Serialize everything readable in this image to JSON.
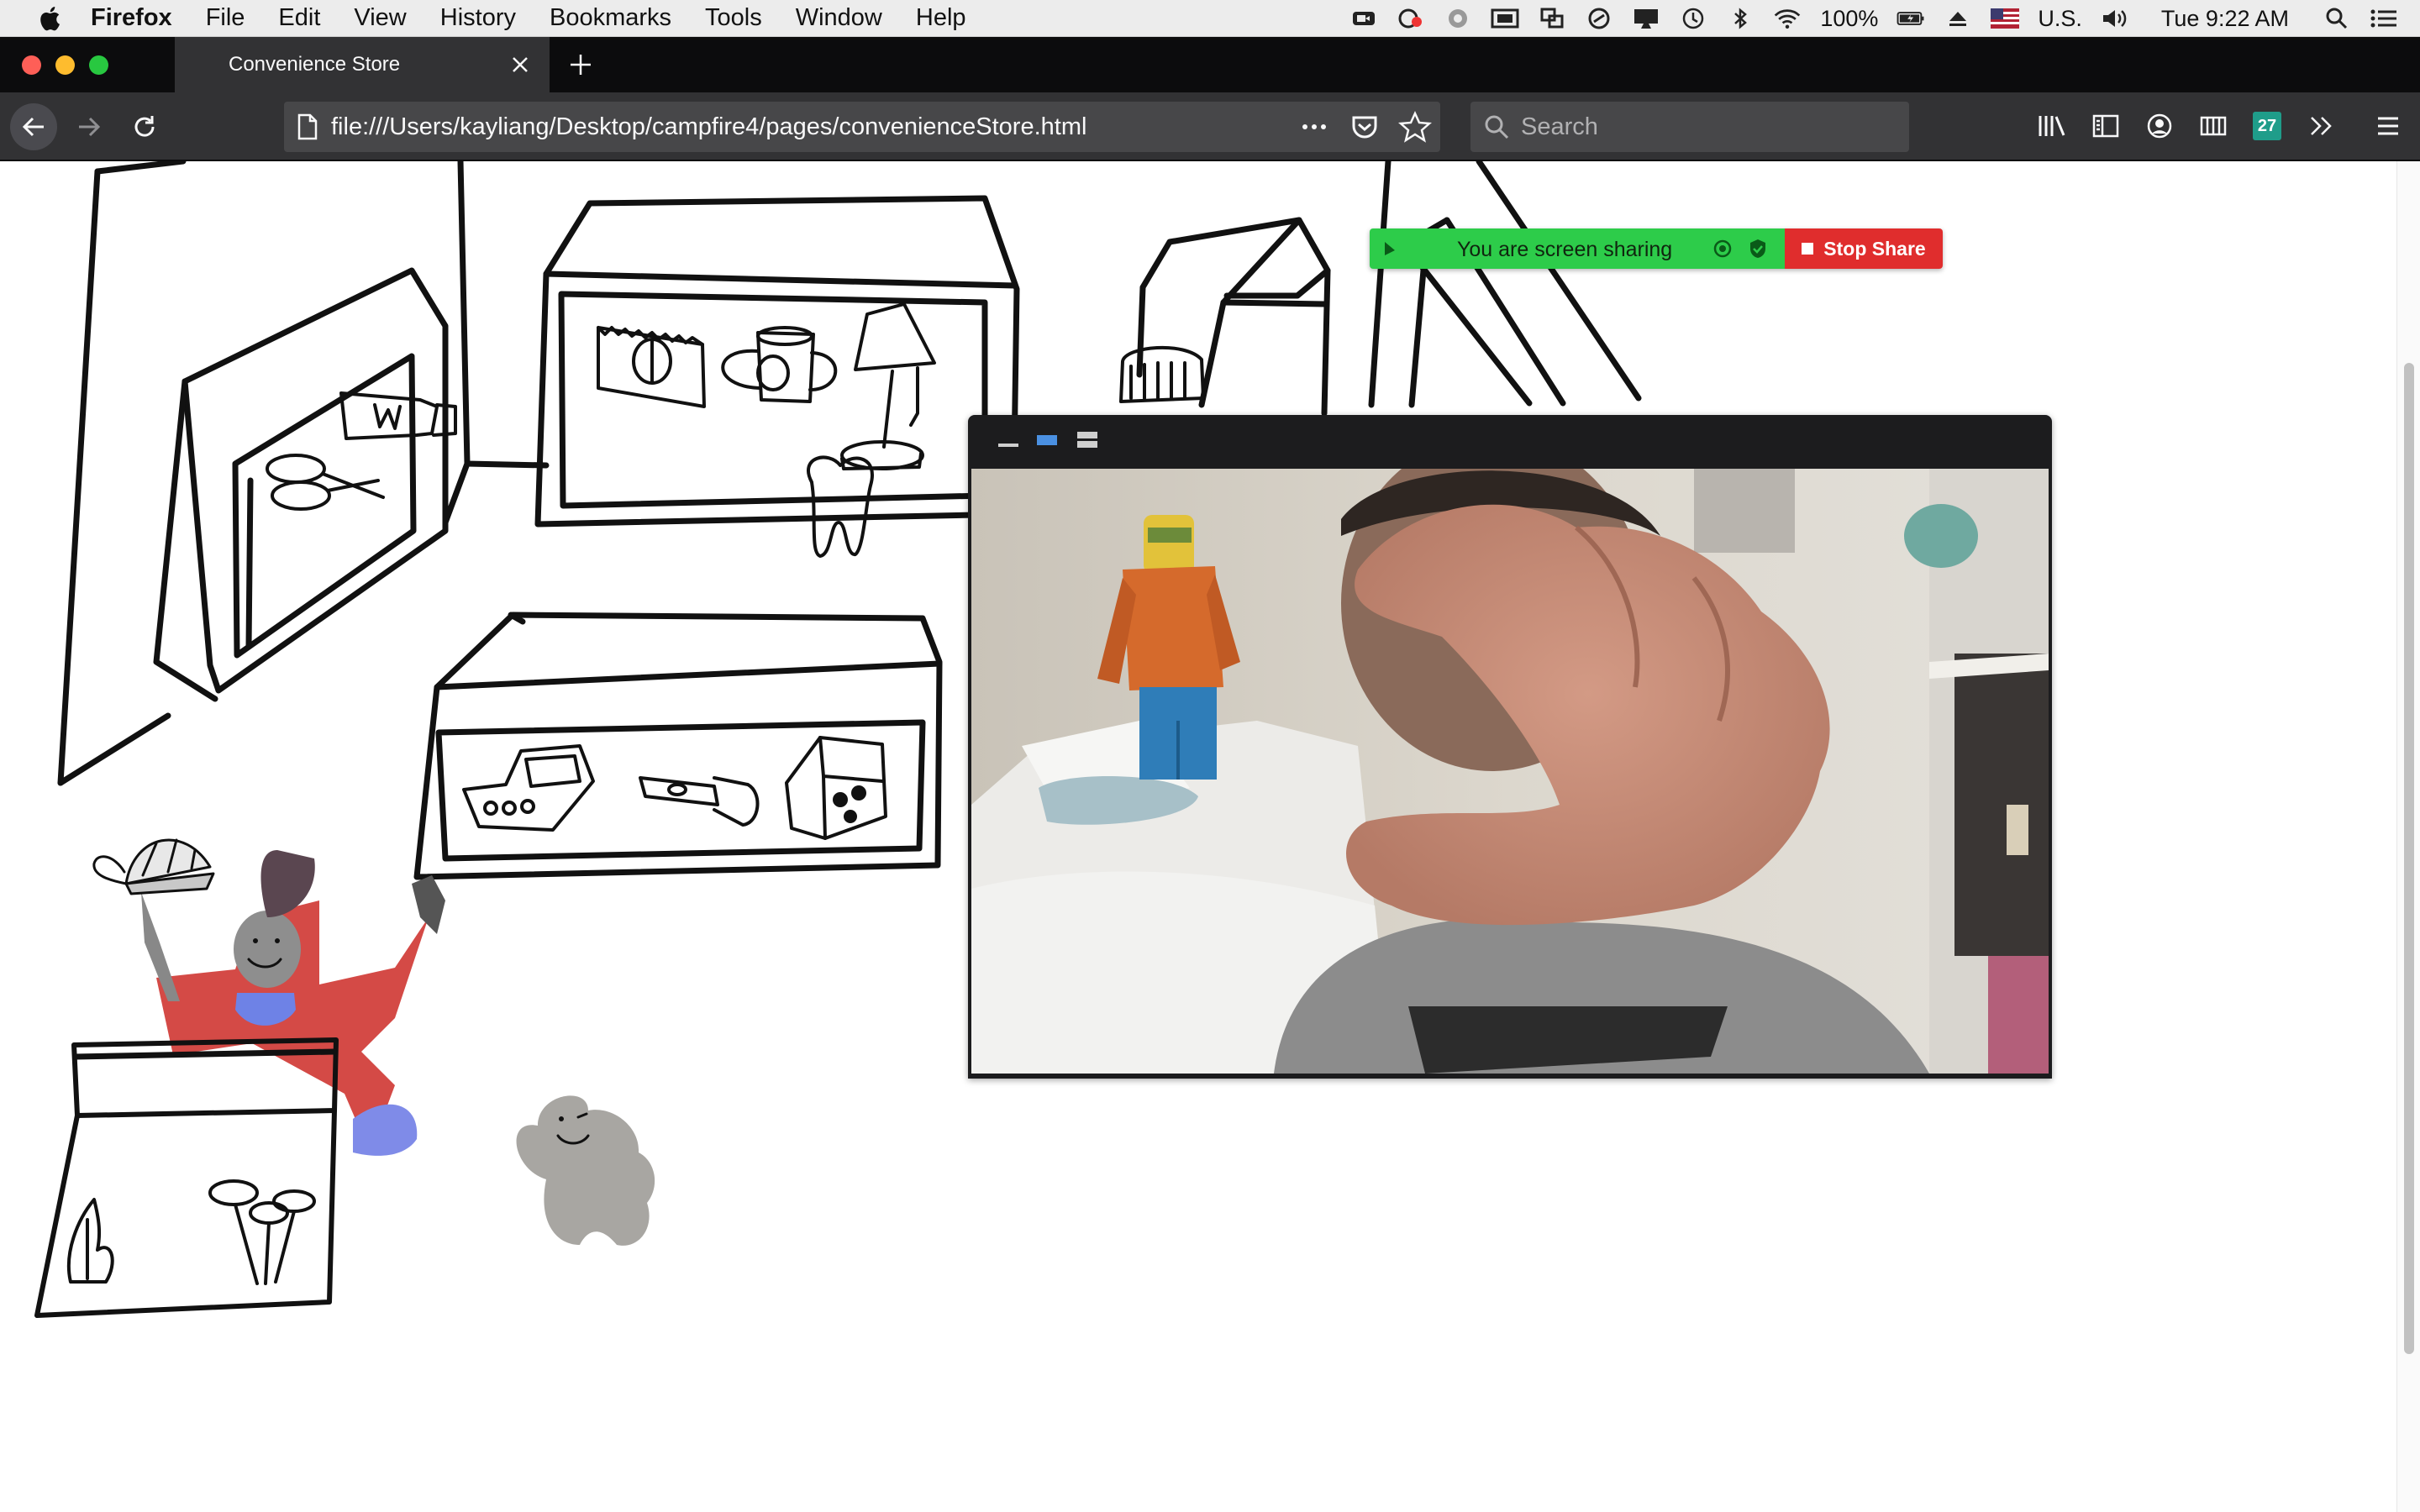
{
  "menubar": {
    "app_name": "Firefox",
    "menus": [
      "File",
      "Edit",
      "View",
      "History",
      "Bookmarks",
      "Tools",
      "Window",
      "Help"
    ],
    "battery": "100%",
    "input_source": "U.S.",
    "clock": "Tue 9:22 AM"
  },
  "tab": {
    "title": "Convenience Store"
  },
  "navbar": {
    "url": "file:///Users/kayliang/Desktop/campfire4/pages/convenienceStore.html",
    "search_placeholder": "Search",
    "calendar_badge": "27"
  },
  "share_banner": {
    "message": "You are screen sharing",
    "stop_label": "Stop Share",
    "green": "#2dcc4a",
    "red": "#e02d2d"
  },
  "video": {
    "controls": [
      "minimize-icon",
      "single-view-icon",
      "grid-view-icon"
    ],
    "active_view": "single-view"
  },
  "icons": {
    "menubar_status": [
      "video-camera-icon",
      "cloud-sync-icon",
      "system-prefs-icon",
      "screen-mirror-icon",
      "window-resize-icon",
      "sync-icon",
      "display-icon",
      "time-machine-icon",
      "bluetooth-icon",
      "wifi-icon",
      "battery-icon",
      "eject-icon",
      "us-flag-icon",
      "volume-icon",
      "spotlight-icon",
      "notification-center-icon"
    ]
  }
}
